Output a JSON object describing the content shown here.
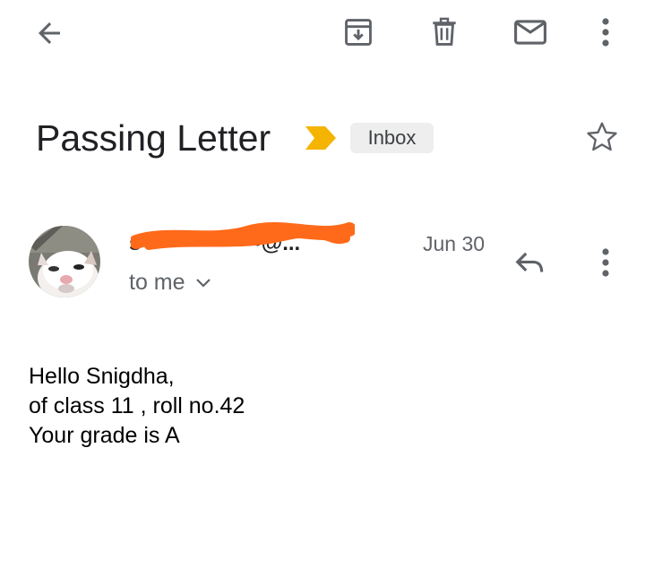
{
  "toolbar": {
    "icons": [
      "back-arrow-icon",
      "archive-icon",
      "delete-icon",
      "mark-unread-icon",
      "more-vert-icon"
    ]
  },
  "message": {
    "subject": "Passing Letter",
    "label": "Inbox",
    "importance_color": "#f4b400",
    "sender": "s••••••••••••••••@...",
    "date": "Jun 30",
    "recipient": "to me",
    "body": [
      "Hello Snigdha,",
      "of class 11 , roll no.42",
      "Your grade is A"
    ]
  },
  "colors": {
    "icon": "#5f6368",
    "redaction": "#ff6a1a"
  }
}
